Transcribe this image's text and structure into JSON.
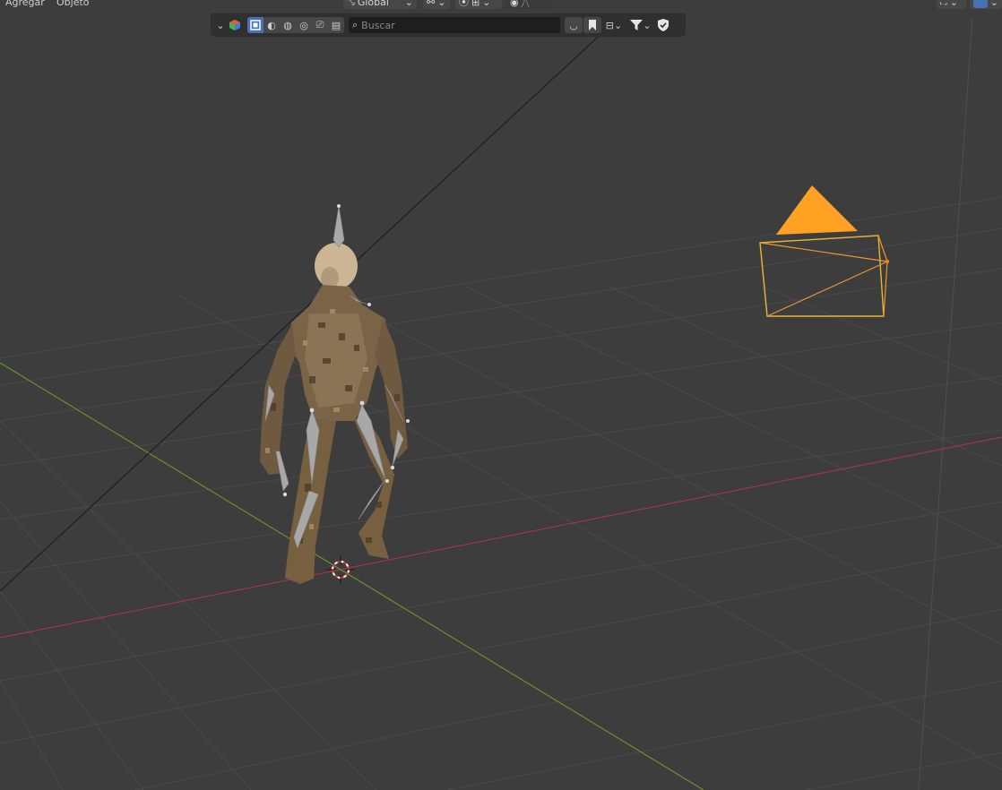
{
  "menu": {
    "add_label": "Agregar",
    "object_label": "Objeto"
  },
  "header": {
    "orientation_label": "Global",
    "icons": [
      "transform-orientation-icon",
      "pivot-point-icon",
      "snap-icon",
      "proportional-editing-icon",
      "gizmo-icon",
      "overlay-toggle-icon"
    ]
  },
  "toolbar": {
    "search_placeholder": "Buscar",
    "icons": [
      "chevron-down-icon",
      "scene-color-icon",
      "object-mode-icon",
      "view-icon",
      "material-icon",
      "world-icon",
      "render-icon",
      "output-icon",
      "search-icon",
      "collapse-icon",
      "bookmark-icon",
      "hierarchy-icon",
      "filter-icon",
      "shield-icon"
    ]
  },
  "viewport": {
    "background_color": "#3d3d3d",
    "x_axis_color": "#9b3a48",
    "y_axis_color": "#6c8e2a",
    "camera_color": "#ffa223",
    "objects": [
      "armature-character",
      "camera",
      "3d-cursor",
      "light-line"
    ]
  }
}
